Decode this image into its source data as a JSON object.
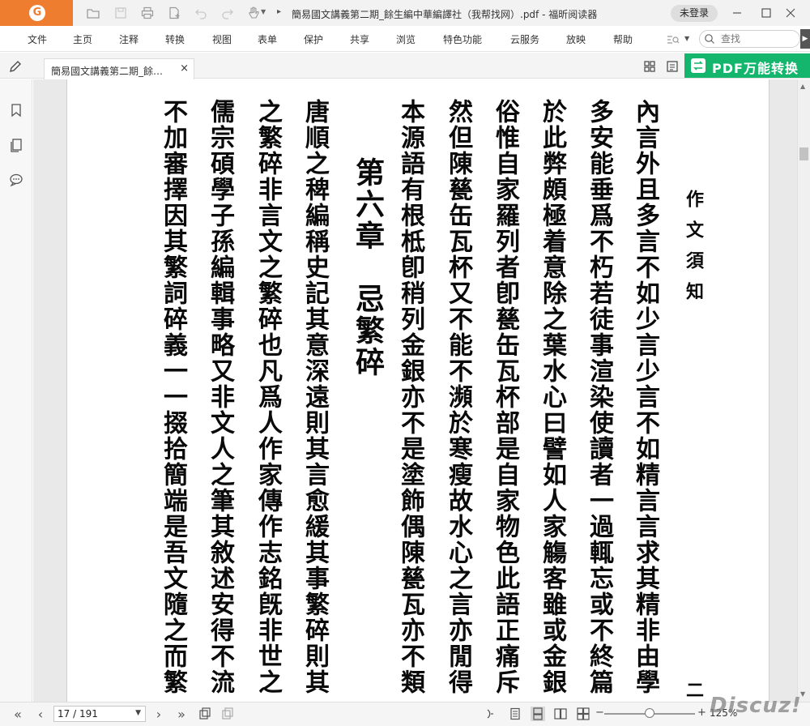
{
  "app": {
    "title": "簡易國文講義第二期_餘生編中華編譯社（我帮找网）.pdf - 福昕阅读器",
    "login_label": "未登录",
    "accent_color": "#ef7d2f",
    "convert_color": "#14b56c"
  },
  "menu": {
    "items": [
      "文件",
      "主页",
      "注释",
      "转换",
      "视图",
      "表单",
      "保护",
      "共享",
      "浏览",
      "特色功能",
      "云服务",
      "放映",
      "帮助"
    ],
    "search_placeholder": "查找"
  },
  "tab": {
    "label": "簡易國文講義第二期_餘生編中華編譯社（我帮找网）.pdf",
    "close_glyph": "×"
  },
  "convert_button": {
    "label": "PDF万能转换"
  },
  "document": {
    "running_title": "作文須知",
    "page_number_fragment": "二",
    "chapter_heading": "第六章　忌繁碎",
    "columns": [
      "內言外且多言不如少言少言不如精言言求其精非由學",
      "多安能垂爲不朽若徒事渲染使讀者一過輒忘或不終篇",
      "於此弊頗極着意除之葉水心曰譬如人家觴客雖或金銀",
      "俗惟自家羅列者卽甆缶瓦杯部是自家物色此語正痛斥",
      "然但陳甆缶瓦杯又不能不瀕於寒瘦故水心之言亦閒得",
      "本源語有根柢卽稍列金銀亦不是塗飾偶陳甆瓦亦不類",
      "唐順之稗編稱史記其意深遠則其言愈緩其事繁碎則其",
      "之繁碎非言文之繁碎也凡爲人作家傳作志銘旣非世之",
      "儒宗碩學子孫編輯事略又非文人之筆其敘述安得不流",
      "不加審擇因其繁詞碎義一一掇拾簡端是吾文隨之而繁"
    ]
  },
  "status": {
    "page_indicator": "17 / 191",
    "zoom_minus": "−",
    "zoom_plus": "+",
    "zoom_level": "125%",
    "zoom_fraction": 0.5,
    "watermark": "Discuz!"
  },
  "icons": {
    "titlebar": [
      "open-folder-icon",
      "save-icon",
      "print-icon",
      "new-page-icon",
      "undo-icon",
      "redo-icon",
      "hand-tool-icon"
    ],
    "sidebar": [
      "bookmark-icon",
      "pages-icon",
      "comments-icon"
    ],
    "status": [
      "first-page-icon",
      "prev-page-icon",
      "next-page-icon",
      "last-page-icon",
      "copy-page-icon",
      "fit-page-icon",
      "single-page-icon",
      "continuous-icon",
      "facing-icon",
      "facing-continuous-icon"
    ]
  }
}
